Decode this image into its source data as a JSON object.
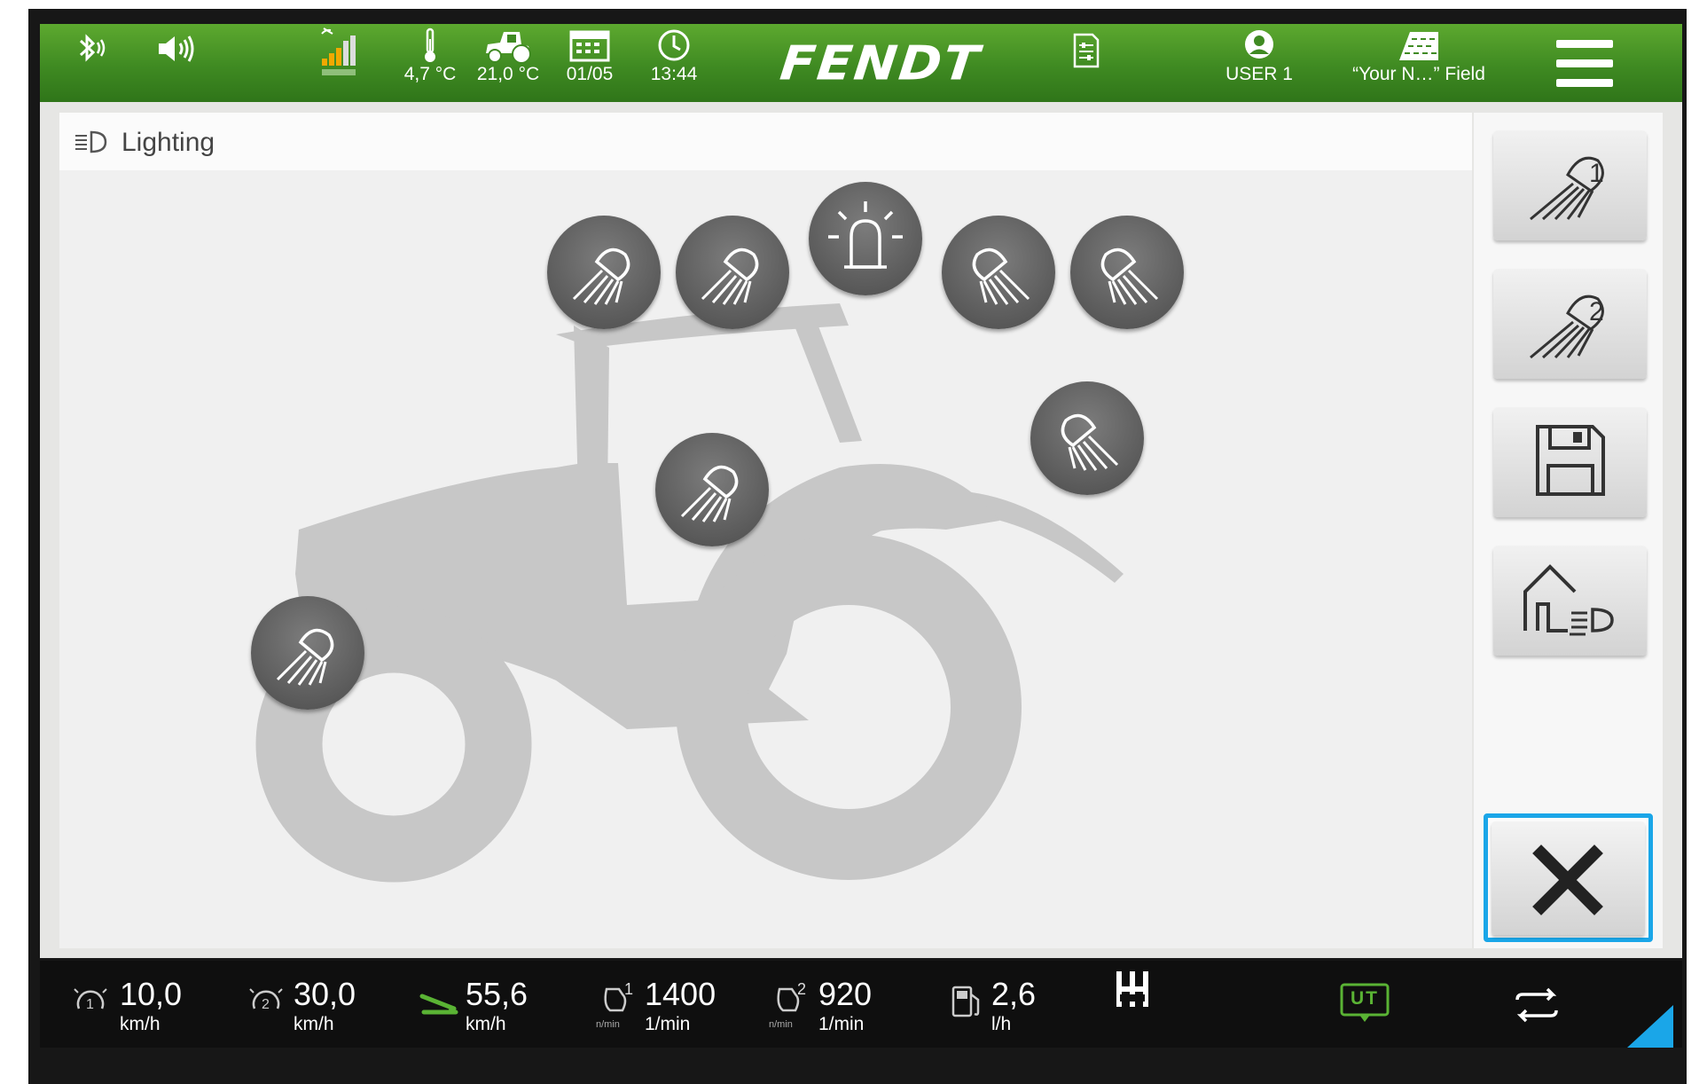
{
  "header": {
    "brand": "FENDT",
    "items": {
      "bluetooth": {
        "icon": "bluetooth-icon"
      },
      "volume": {
        "icon": "speaker-icon"
      },
      "signal": {
        "icon": "signal-strength-icon"
      },
      "outside_temp": {
        "icon": "thermometer-icon",
        "label": "4,7 °C"
      },
      "tractor_temp": {
        "icon": "tractor-temperature-icon",
        "label": "21,0 °C"
      },
      "date": {
        "icon": "calendar-icon",
        "label": "01/05"
      },
      "time": {
        "icon": "clock-icon",
        "label": "13:44"
      },
      "job": {
        "icon": "document-icon"
      },
      "user": {
        "icon": "user-icon",
        "label": "USER 1"
      },
      "field": {
        "icon": "field-icon",
        "label": "“Your N…” Field"
      }
    }
  },
  "page": {
    "title": "Lighting",
    "title_icon": "headlight-icon"
  },
  "lights": [
    {
      "id": "roof-front-left-outer",
      "icon": "headlight-icon"
    },
    {
      "id": "roof-front-left-inner",
      "icon": "headlight-icon"
    },
    {
      "id": "beacon",
      "icon": "beacon-icon"
    },
    {
      "id": "roof-rear-right-inner",
      "icon": "headlight-icon"
    },
    {
      "id": "roof-rear-right-outer",
      "icon": "headlight-icon"
    },
    {
      "id": "cab-pillar",
      "icon": "headlight-icon"
    },
    {
      "id": "rear-fender",
      "icon": "headlight-icon"
    },
    {
      "id": "front-hood",
      "icon": "headlight-icon"
    }
  ],
  "sidebar": {
    "buttons": [
      {
        "icon": "light-memory-1-icon",
        "number": "1"
      },
      {
        "icon": "light-memory-2-icon",
        "number": "2"
      },
      {
        "icon": "save-icon"
      },
      {
        "icon": "home-light-icon"
      }
    ],
    "close_icon": "close-icon",
    "colors": {
      "close_border": "#1aa6e8"
    }
  },
  "status": {
    "items": [
      {
        "icon": "speed-1-icon",
        "value": "10,0",
        "unit": "km/h"
      },
      {
        "icon": "speed-2-icon",
        "value": "30,0",
        "unit": "km/h"
      },
      {
        "icon": "accelerator-pedal-icon",
        "value": "55,6",
        "unit": "km/h"
      },
      {
        "icon": "engine-speed-1-icon",
        "sub": "1",
        "small": "n/min",
        "value": "1400",
        "unit": "1/min"
      },
      {
        "icon": "engine-speed-2-icon",
        "sub": "2",
        "small": "n/min",
        "value": "920",
        "unit": "1/min"
      },
      {
        "icon": "fuel-icon",
        "value": "2,6",
        "unit": "l/h"
      }
    ],
    "transmission_icon": "gearshift-icon",
    "ut": {
      "icon": "ut-icon",
      "label": "UT"
    },
    "switch_icon": "switch-view-icon",
    "colors": {
      "ut": "#5ab334",
      "corner": "#1aa6e8",
      "accelerator": "#5ab334"
    }
  },
  "colors": {
    "header_top": "#5da92f",
    "header_bottom": "#2f7519",
    "tractor": "#c7c7c7",
    "light_button": "#5f5f5f"
  }
}
